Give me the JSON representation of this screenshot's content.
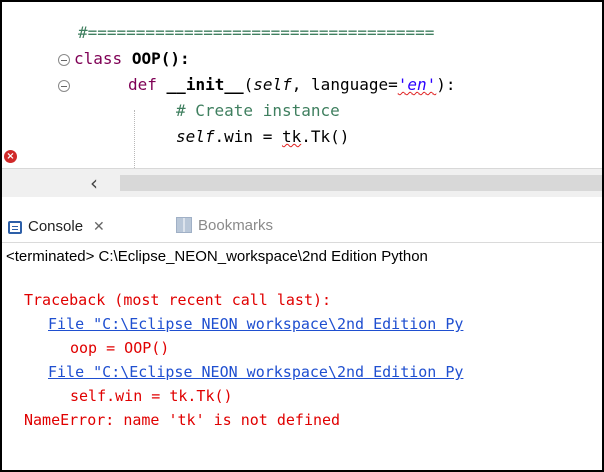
{
  "editor": {
    "separator": "#====================================",
    "class_kw": "class",
    "class_name": "OOP():",
    "def_kw": "def",
    "init_name": "__init__",
    "init_paren_open": "(",
    "init_self": "self",
    "init_rest_a": ", language=",
    "init_string": "'en'",
    "init_rest_b": "):",
    "comment": "# Create instance",
    "assign_self": "self",
    "assign_a": ".win = ",
    "assign_tk": "tk",
    "assign_b": ".Tk()",
    "error_marker": "×",
    "scroll_left": "‹"
  },
  "console": {
    "tabs": {
      "console_label": "Console",
      "close_symbol": "✕",
      "bookmarks_label": "Bookmarks"
    },
    "status": "<terminated> C:\\Eclipse_NEON_workspace\\2nd Edition Python",
    "lines": [
      "Traceback (most recent call last):",
      "File \"C:\\Eclipse NEON workspace\\2nd Edition Py",
      "oop = OOP()",
      "File \"C:\\Eclipse NEON workspace\\2nd Edition Py",
      "self.win = tk.Tk()",
      "NameError: name 'tk' is not defined"
    ]
  },
  "colors": {
    "keyword": "#7f0055",
    "comment": "#3f7f5f",
    "string": "#2a00ff",
    "error_text": "#e00000",
    "link": "#1f4fd0"
  }
}
